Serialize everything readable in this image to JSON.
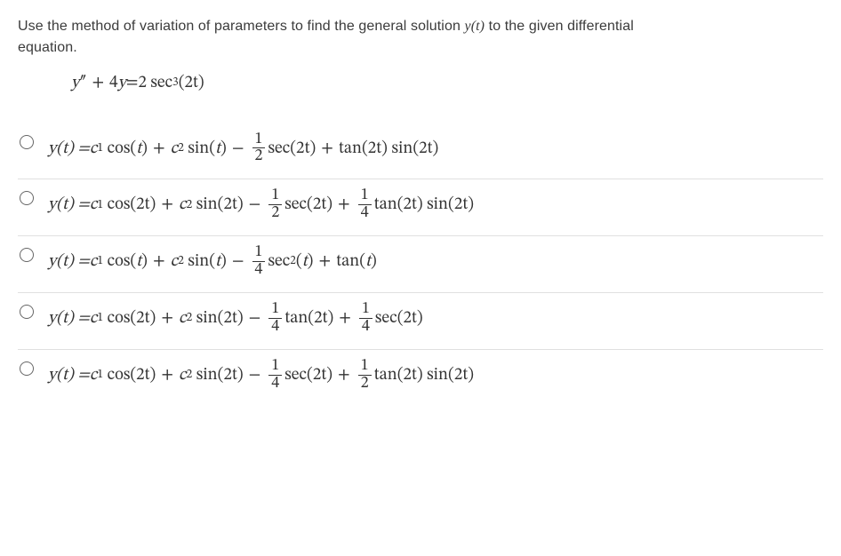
{
  "prompt": {
    "line1": "Use the method of variation of parameters to find the general solution ",
    "yoft": "y(t)",
    "line1b": " to the given differential",
    "line2": "equation."
  },
  "equation": {
    "lhs_y": "y",
    "lhs_pp": "″",
    "plus": " +",
    "coef4": "4",
    "yvar": "y",
    "eq": " = ",
    "two": "2",
    "sec": "sec",
    "cube": "3",
    "lpar": "(",
    "twot": "2t",
    "rpar": ")"
  },
  "fractions": {
    "one": "1",
    "two": "2",
    "four": "4"
  },
  "sym": {
    "yoft_eq": "y(t) = ",
    "c1": "c",
    "c2": "c",
    "sub1": "1",
    "sub2": "2",
    "cos": "cos",
    "sin": "sin",
    "sec": "sec",
    "tan": "tan",
    "t": "t",
    "twot": "2t",
    "lpar": "(",
    "rpar": ")",
    "plus": " + ",
    "minus": " − ",
    "sq": "2"
  }
}
